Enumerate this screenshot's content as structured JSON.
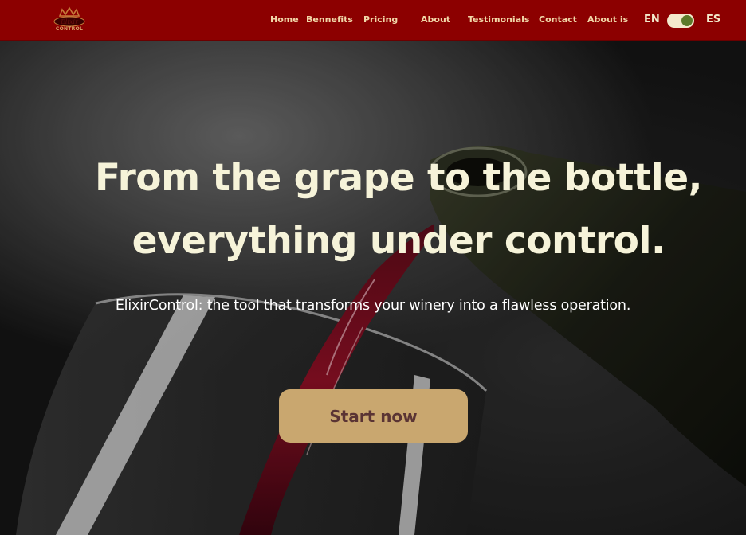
{
  "brand": {
    "logo_text": "CONTROL",
    "colors": {
      "navbar": "#8c0000",
      "nav_text": "#f1d7a8",
      "headline": "#f6f3d9",
      "cta_background": "#c9a76f",
      "cta_text": "#5a3434",
      "toggle_knob": "#5c7a2a"
    }
  },
  "nav": {
    "links": [
      {
        "label": "Home"
      },
      {
        "label": "Bennefits"
      },
      {
        "label": "Pricing"
      },
      {
        "label": "About"
      },
      {
        "label": "Testimonials"
      },
      {
        "label": "Contact"
      },
      {
        "label": "About is"
      }
    ],
    "language": {
      "left": "EN",
      "right": "ES",
      "toggle_on": true
    }
  },
  "hero": {
    "title_line1": "From the grape to the bottle,",
    "title_line2": "everything under control.",
    "subtitle": "ElixirControl: the tool that transforms your winery into a flawless operation.",
    "cta_label": "Start now",
    "background_image": "wine being poured from a bottle into a glass"
  }
}
